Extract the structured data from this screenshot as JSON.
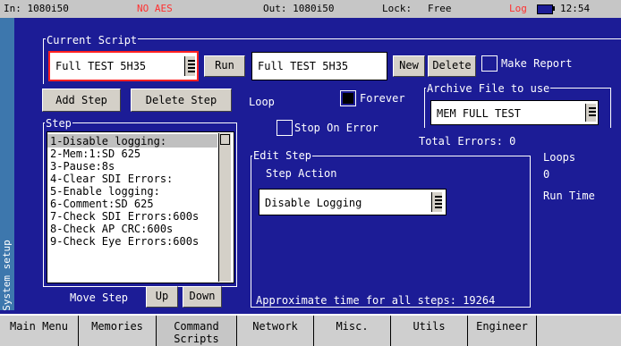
{
  "status": {
    "input": "In: 1080i50",
    "aes": "NO AES",
    "output": "Out: 1080i50",
    "lock_label": "Lock:",
    "lock_value": "Free",
    "log": "Log",
    "time": "12:54",
    "colors": {
      "alert": "#ff3030"
    }
  },
  "side_tab": {
    "label": "System setup"
  },
  "current_script": {
    "legend": "Current Script",
    "selected": "Full TEST 5H35",
    "run_label": "Run",
    "name_value": "Full TEST 5H35",
    "new_label": "New",
    "delete_label": "Delete",
    "make_report_label": "Make Report"
  },
  "actions": {
    "add_step": "Add Step",
    "delete_step": "Delete Step"
  },
  "loop": {
    "label": "Loop",
    "forever_label": "Forever",
    "stop_on_error_label": "Stop On Error"
  },
  "archive": {
    "legend": "Archive File to use",
    "value": "MEM FULL TEST"
  },
  "step_list": {
    "legend": "Step",
    "items": [
      "1-Disable logging:",
      "2-Mem:1:SD 625",
      "3-Pause:8s",
      "4-Clear SDI Errors:",
      "5-Enable logging:",
      "6-Comment:SD 625",
      "7-Check SDI Errors:600s",
      "8-Check AP CRC:600s",
      "9-Check Eye Errors:600s"
    ],
    "move_step_label": "Move Step",
    "up_label": "Up",
    "down_label": "Down"
  },
  "stats": {
    "total_errors": "Total Errors: 0",
    "loops_label": "Loops",
    "loops_value": "0",
    "run_time_label": "Run Time",
    "approx_time": "Approximate time for all steps: 19264"
  },
  "edit_step": {
    "legend": "Edit Step",
    "action_label": "Step Action",
    "action_value": "Disable Logging"
  },
  "tabs": [
    "Main Menu",
    "Memories",
    "Command Scripts",
    "Network",
    "Misc.",
    "Utils",
    "Engineer",
    ""
  ]
}
